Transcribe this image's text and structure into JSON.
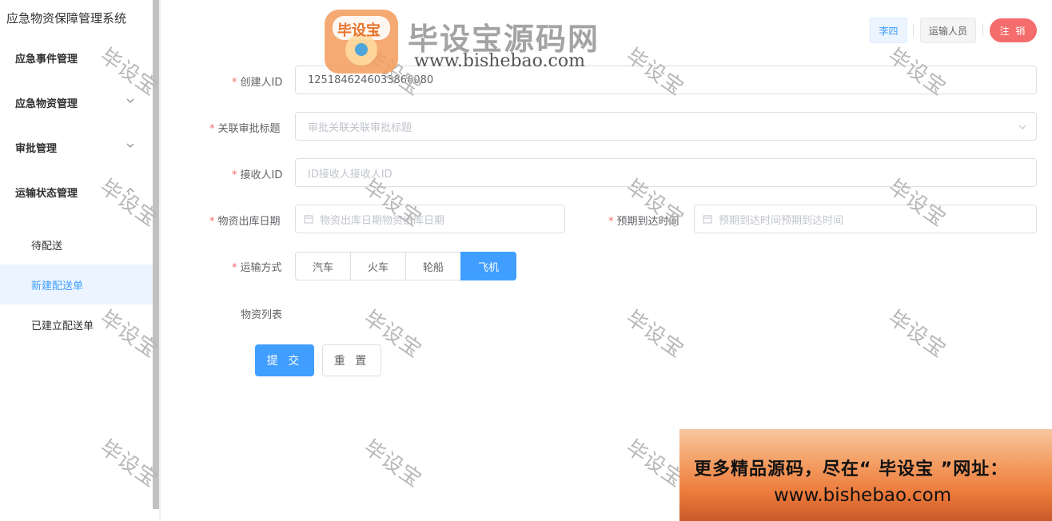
{
  "app": {
    "title": "应急物资保障管理系统"
  },
  "sidebar": {
    "items": [
      {
        "label": "应急事件管理"
      },
      {
        "label": "应急物资管理"
      },
      {
        "label": "审批管理"
      },
      {
        "label": "运输状态管理"
      }
    ],
    "sub_items": [
      {
        "label": "待配送"
      },
      {
        "label": "新建配送单",
        "active": true
      },
      {
        "label": "已建立配送单"
      }
    ]
  },
  "header": {
    "user_name": "李四",
    "role": "运输人员",
    "logout_label": "注 销"
  },
  "form": {
    "creator_id": {
      "label": "创建人ID",
      "value": "1251846246033866080"
    },
    "approval_title": {
      "label": "关联审批标题",
      "placeholder": "审批关联关联审批标题"
    },
    "receiver_id": {
      "label": "接收人ID",
      "placeholder": "ID接收人接收人ID"
    },
    "outbound_date": {
      "label": "物资出库日期",
      "placeholder": "物资出库日期物资出库日期"
    },
    "arrival_time": {
      "label": "预期到达时间",
      "placeholder": "预期到达时间预期到达时间"
    },
    "transport": {
      "label": "运输方式",
      "options": [
        "汽车",
        "火车",
        "轮船",
        "飞机"
      ],
      "selected": "飞机"
    },
    "materials_label": "物资列表",
    "submit_label": "提 交",
    "reset_label": "重 置"
  },
  "watermark": {
    "logo_text": "毕设宝源码网",
    "logo_badge": "毕设宝",
    "logo_url": "www.bishebao.com",
    "tile_text": "毕设宝",
    "banner_line1": "更多精品源码，尽在“ 毕设宝 ”网址：",
    "banner_line2": "www.bishebao.com"
  },
  "colors": {
    "primary": "#409eff",
    "danger": "#f56c6c",
    "active_bg": "#ecf5ff"
  }
}
